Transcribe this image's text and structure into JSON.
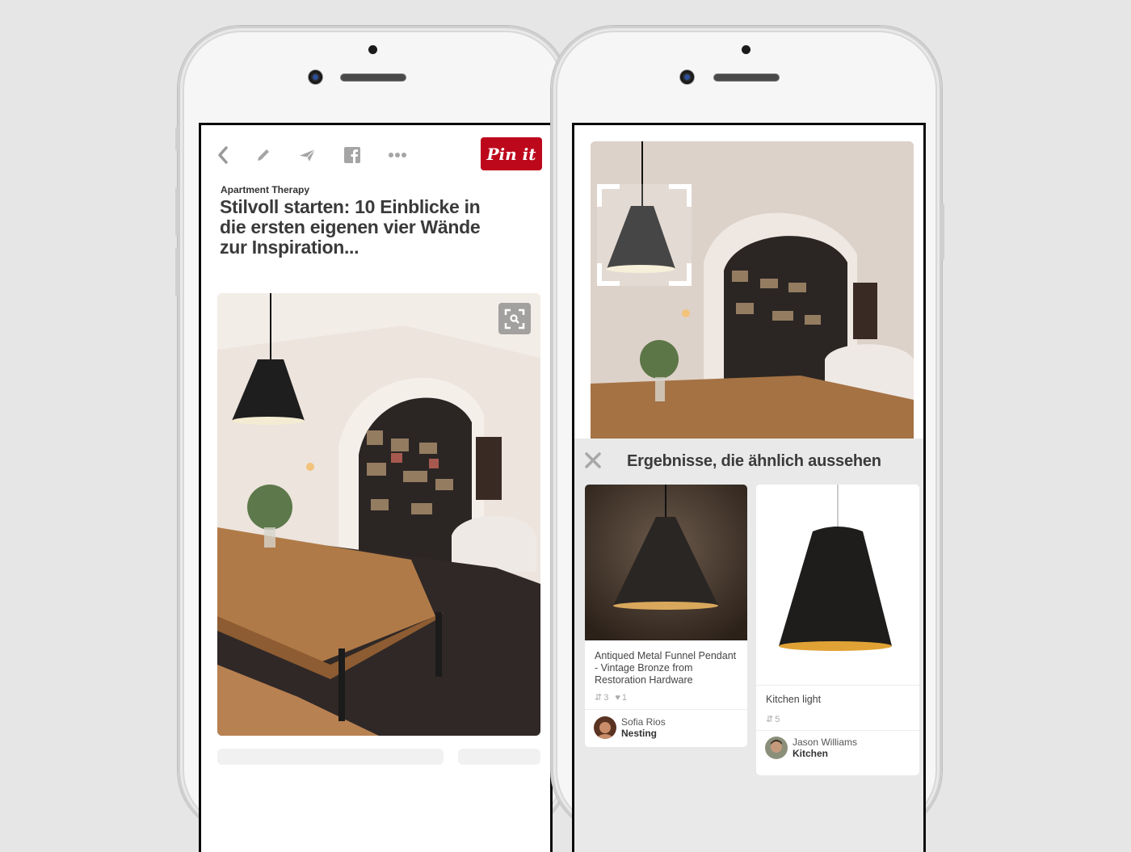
{
  "left_phone": {
    "toolbar": {
      "icons": [
        "back-chevron-icon",
        "edit-pencil-icon",
        "send-icon",
        "facebook-icon",
        "more-dots-icon"
      ],
      "pin_button_label": "Pin it",
      "pin_button_color": "#bd081c"
    },
    "source": "Apartment Therapy",
    "title": "Stilvoll starten: 10 Einblicke in die ersten eigenen vier Wände zur Inspiration...",
    "photo": {
      "description": "Dining room with black pendant lamp, wooden table and bookshelf",
      "visual_search_icon": "visual-search-icon"
    }
  },
  "right_phone": {
    "photo": {
      "description": "Same dining room photo with crop selection around pendant lamp"
    },
    "results": {
      "close_icon": "close-icon",
      "title": "Ergebnisse, die ähnlich aussehen",
      "cards": [
        {
          "description": "Antiqued Metal Funnel Pendant - Vintage Bronze from Restoration Hardware",
          "repins": "3",
          "likes": "1",
          "pinner_name": "Sofia Rios",
          "board": "Nesting"
        },
        {
          "description": "Kitchen light",
          "repins": "5",
          "pinner_name": "Jason Williams",
          "board": "Kitchen"
        }
      ]
    }
  }
}
